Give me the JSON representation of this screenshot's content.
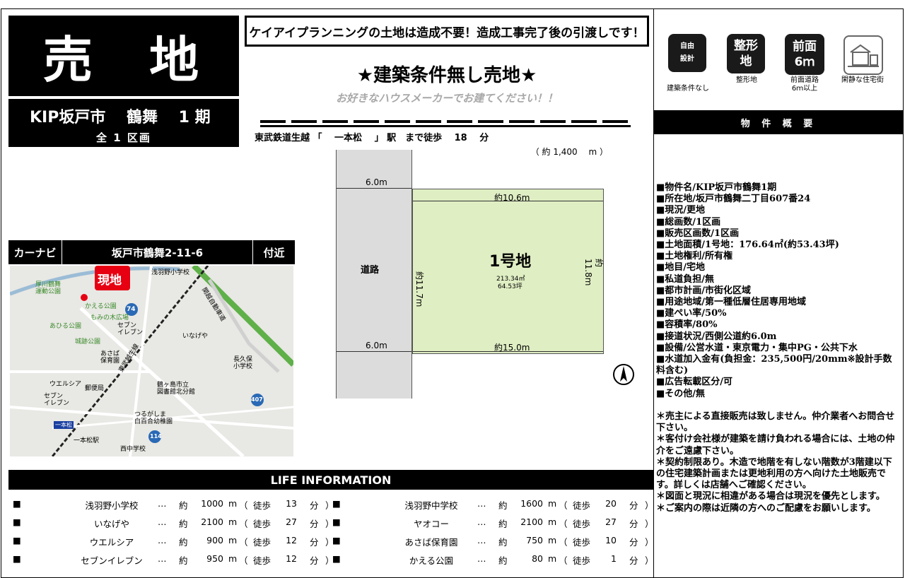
{
  "header": {
    "title": "売 地",
    "project": "KIP坂戸市　 鶴舞　 1 期",
    "lots_total": "全 1 区画",
    "banner": "ケイアイプランニングの土地は造成不要！造成工事完了後の引渡しです！",
    "headline": "★建築条件無し売地★",
    "subheadline": "お好きなハウスメーカーでお建てください！！"
  },
  "access": {
    "station_line": "東武鉄道生越 「　 一本松 　」 駅　まで徒歩　 18 　分",
    "distance": "（ 約 1,400 　m ）"
  },
  "site_plan": {
    "road_width_top": "6.0m",
    "road_width_bottom": "6.0m",
    "road_label": "道路",
    "frontage_top": "約10.6m",
    "frontage_bottom": "約15.0m",
    "side_left": "約11.7m",
    "side_right": "約11.8m",
    "lot_no": "1号地",
    "lot_area_m2": "213.34㎡",
    "lot_area_tsubo": "64.53坪"
  },
  "features": [
    {
      "icon": "free-design-icon",
      "label": "自由\n設計",
      "caption": "建築条件なし"
    },
    {
      "icon": "shaped-lot-icon",
      "label": "整形\n地",
      "caption": "整形地"
    },
    {
      "icon": "front-road-icon",
      "label": "前面\n6ｍ",
      "caption": "前面道路\n6ｍ以上"
    },
    {
      "icon": "quiet-residential-icon",
      "label": "",
      "caption": "閑静な住宅街"
    }
  ],
  "summary": {
    "heading": "物 件 概 要",
    "items": [
      "■物件名/KIP坂戸市鶴舞1期",
      "■所在地/坂戸市鶴舞二丁目607番24",
      "■現況/更地",
      "■総画数/1区画",
      "■販売区画数/1区画",
      "■土地面積/1号地：176.64㎡(約53.43坪)",
      "■土地権利/所有権",
      "■地目/宅地",
      "■私道負担/無",
      "■都市計画/市街化区域",
      "■用途地域/第一種低層住居専用地域",
      "■建ぺい率/50%",
      "■容積率/80%",
      "■接道状況/西側公道約6.0m",
      "■設備/公営水道・東京電力・集中PG・公共下水",
      "■水道加入金有(負担金：235,500円/20mm※設計手数料含む)",
      "■広告転載区分/可",
      "■その他/無"
    ],
    "notes": [
      "＊売主による直接販売は致しません。仲介業者へお問合せ下さい。",
      "＊客付け会社様が建築を請け負われる場合には、土地の仲介をご遠慮下さい。",
      "＊契約制限あり。木造で地階を有しない階数が3階建以下の住宅建築計画または更地利用の方へ向けた土地販売です。詳しくは店舗へご確認ください。",
      "＊図面と現況に相違がある場合は現況を優先とします。",
      "＊ご案内の際は近隣の方へのご配慮をお願いします。"
    ]
  },
  "map": {
    "nav_label": "カーナビ",
    "address": "坂戸市鶴舞2-11-6",
    "near": "付近",
    "current_label": "現地",
    "places": [
      "浅羽野小学校",
      "厚川鶴舞\n運動公園",
      "かえる公園",
      "もみの木広場",
      "あひる公園",
      "セブン\nイレブン",
      "城跡公園",
      "いなげや",
      "あさば\n保育園",
      "長久保\n小学校",
      "ウエルシア",
      "郵便局",
      "鶴ヶ島市立\n図書館北分館",
      "セブン\nイレブン",
      "つるがしま\n白百合幼稚園",
      "一本松",
      "一本松駅",
      "西中学校",
      "東武越生線",
      "関越自動車道"
    ],
    "route_numbers": [
      "74",
      "407",
      "114"
    ]
  },
  "life": {
    "heading": "LIFE INFORMATION",
    "left": [
      {
        "name": "浅羽野小学校",
        "m": "1000",
        "min": "13"
      },
      {
        "name": "いなげや",
        "m": "2100",
        "min": "27"
      },
      {
        "name": "ウエルシア",
        "m": "900",
        "min": "12"
      },
      {
        "name": "セブンイレブン",
        "m": "950",
        "min": "12"
      }
    ],
    "right": [
      {
        "name": "浅羽野中学校",
        "m": "1600",
        "min": "20"
      },
      {
        "name": "ヤオコー",
        "m": "2100",
        "min": "27"
      },
      {
        "name": "あさば保育園",
        "m": "750",
        "min": "10"
      },
      {
        "name": "かえる公園",
        "m": "80",
        "min": "1"
      }
    ],
    "bullet": "■",
    "dots": "…",
    "approx": "約",
    "unit_m": "m",
    "paren_open": "（",
    "walk": "徒歩",
    "unit_min": "分",
    "paren_close": "）"
  }
}
